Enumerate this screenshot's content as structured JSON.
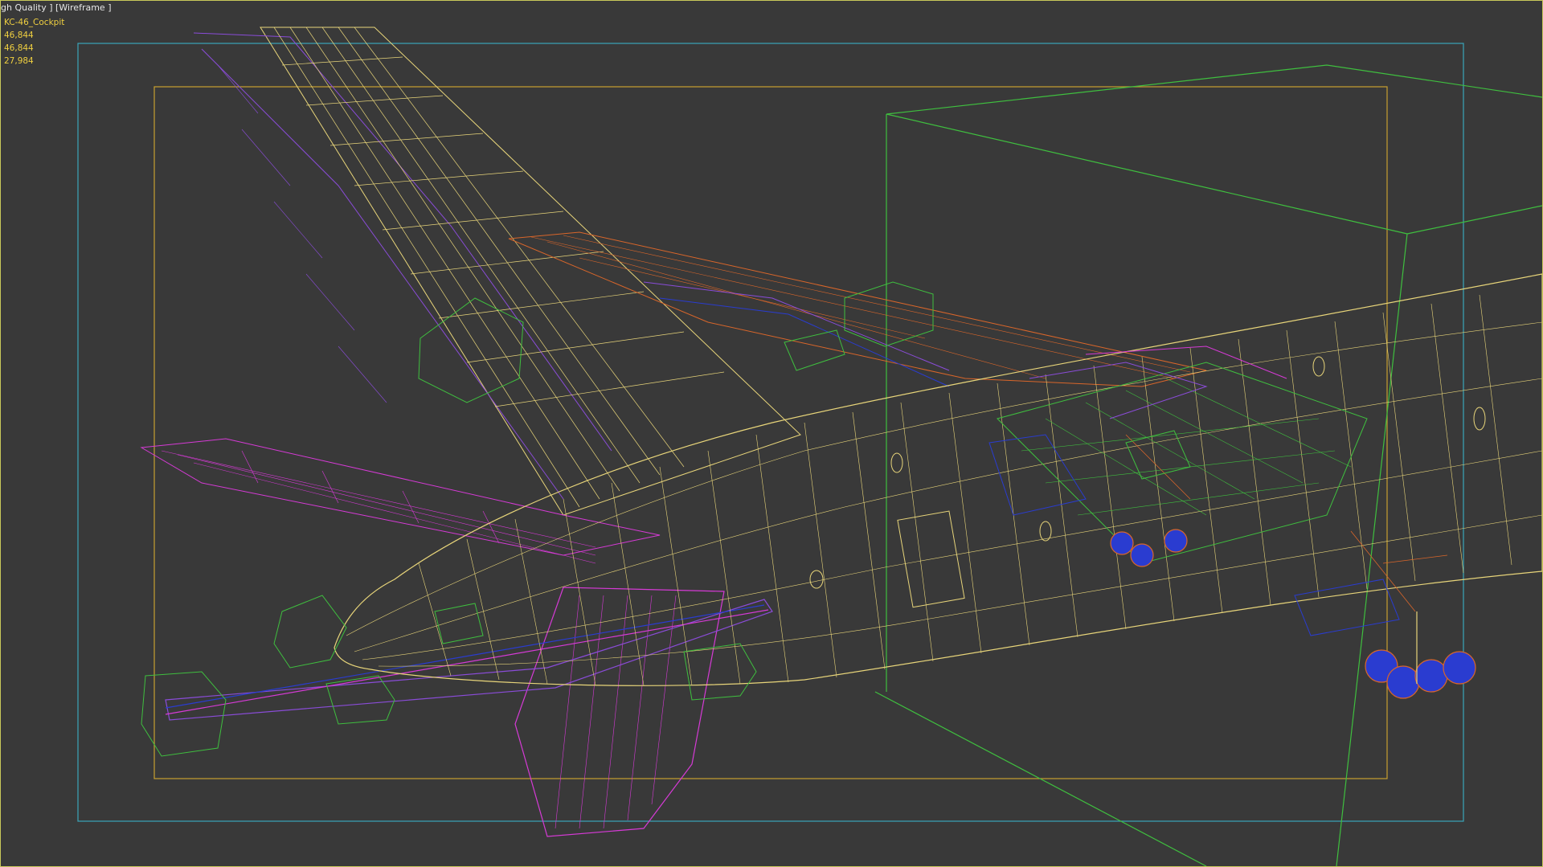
{
  "viewport": {
    "quality_label": "gh Quality ]",
    "mode_label": "[Wireframe ]"
  },
  "stats": {
    "object_name": "KC-46_Cockpit",
    "polys": "46,844",
    "tris": "46,844",
    "verts": "27,984"
  },
  "colors": {
    "viewport_bg": "#393939",
    "viewport_border": "#c8c85a",
    "safe_frame_outer": "#3aa6b9",
    "safe_frame_inner": "#c8a030",
    "fuselage_wire": "#e8d57a",
    "wing_wire": "#d9662a",
    "stabilizer_wire": "#d63ad6",
    "fin_wire": "#8a4cd8",
    "bbox_green": "#3fbf3f",
    "gear_blue": "#2a3cd0"
  }
}
